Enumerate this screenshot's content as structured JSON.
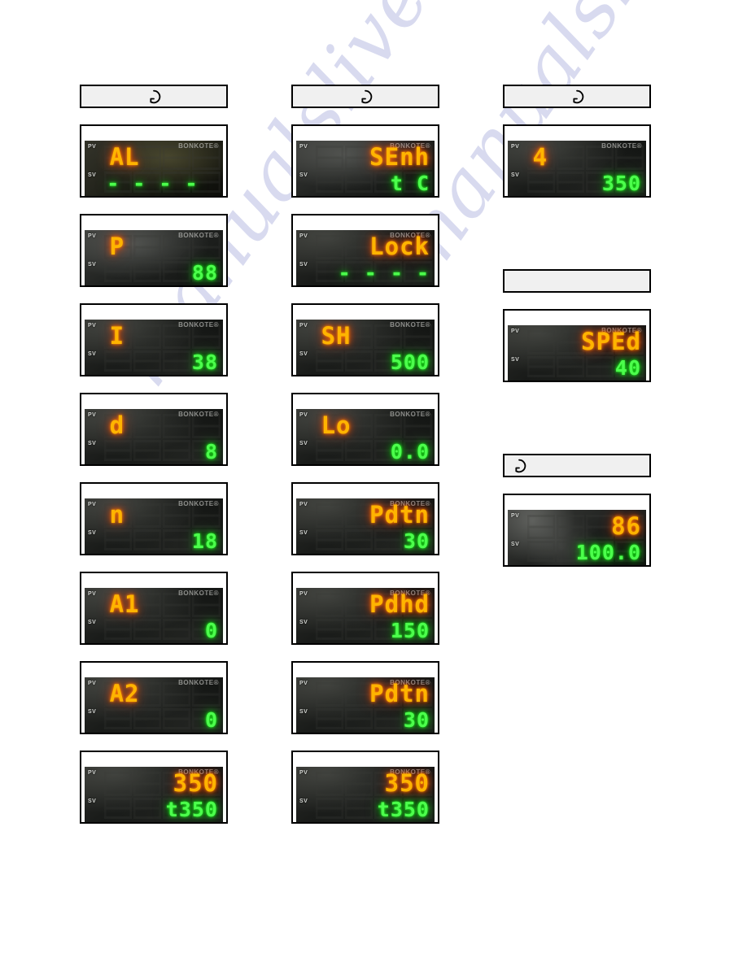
{
  "page": {
    "watermark": "manualslive.com",
    "brand": "BONKOTE®",
    "pv_tag": "PV",
    "sv_tag": "SV"
  },
  "icons": {
    "cycle": "circular-arrow-icon"
  },
  "columns": [
    {
      "id": "column-1",
      "header": {
        "icon": "circular-arrow-icon",
        "align": "center",
        "label": ""
      },
      "panels": [
        {
          "id": "c1-p1",
          "pv": "AL",
          "sv": "- - - -",
          "pv_align": "left",
          "sv_align": "left",
          "screen": "olive"
        },
        {
          "id": "c1-p2",
          "pv": "P",
          "sv": "88",
          "pv_align": "left",
          "sv_align": "right",
          "screen": "grey"
        },
        {
          "id": "c1-p3",
          "pv": "I",
          "sv": "38",
          "pv_align": "left",
          "sv_align": "right",
          "screen": "dark"
        },
        {
          "id": "c1-p4",
          "pv": "d",
          "sv": "8",
          "pv_align": "left",
          "sv_align": "right",
          "screen": "dark"
        },
        {
          "id": "c1-p5",
          "pv": "n",
          "sv": "18",
          "pv_align": "left",
          "sv_align": "right",
          "screen": "dark"
        },
        {
          "id": "c1-p6",
          "pv": "A1",
          "sv": "0",
          "pv_align": "left",
          "sv_align": "right",
          "screen": "dark"
        },
        {
          "id": "c1-p7",
          "pv": "A2",
          "sv": "0",
          "pv_align": "left",
          "sv_align": "right",
          "screen": "dark"
        },
        {
          "id": "c1-p8",
          "pv": "350",
          "sv": "t350",
          "pv_align": "right",
          "sv_align": "right",
          "screen": "dark"
        }
      ]
    },
    {
      "id": "column-2",
      "header": {
        "icon": "circular-arrow-icon",
        "align": "center",
        "label": ""
      },
      "panels": [
        {
          "id": "c2-p1",
          "pv": "SEnh",
          "sv": "t    C",
          "pv_align": "right",
          "sv_align": "right",
          "screen": "grey"
        },
        {
          "id": "c2-p2",
          "pv": "Lock",
          "sv": "- - - -",
          "pv_align": "right",
          "sv_align": "right",
          "screen": "dark"
        },
        {
          "id": "c2-p3",
          "pv": "SH",
          "sv": "500",
          "pv_align": "left",
          "sv_align": "right",
          "screen": "dark"
        },
        {
          "id": "c2-p4",
          "pv": "Lo",
          "sv": "0.0",
          "pv_align": "left",
          "sv_align": "right",
          "screen": "dark"
        },
        {
          "id": "c2-p5",
          "pv": "Pdtn",
          "sv": "30",
          "pv_align": "right",
          "sv_align": "right",
          "screen": "dark"
        },
        {
          "id": "c2-p6",
          "pv": "Pdhd",
          "sv": "150",
          "pv_align": "right",
          "sv_align": "right",
          "screen": "dark"
        },
        {
          "id": "c2-p7",
          "pv": "Pdtn",
          "sv": "30",
          "pv_align": "right",
          "sv_align": "right",
          "screen": "dark"
        },
        {
          "id": "c2-p8",
          "pv": "350",
          "sv": "t350",
          "pv_align": "right",
          "sv_align": "right",
          "screen": "dark"
        }
      ]
    },
    {
      "id": "column-3",
      "groups": [
        {
          "header": {
            "icon": "circular-arrow-icon",
            "align": "center",
            "label": ""
          },
          "panels": [
            {
              "id": "c3-p1",
              "pv": "4",
              "sv": "350",
              "pv_align": "left",
              "sv_align": "right",
              "screen": "dark"
            }
          ]
        },
        {
          "header": {
            "icon": "",
            "align": "center",
            "label": ""
          },
          "panels": [
            {
              "id": "c3-p2",
              "pv": "SPEd",
              "sv": "40",
              "pv_align": "right",
              "sv_align": "right",
              "screen": "dark"
            }
          ]
        },
        {
          "header": {
            "icon": "circular-arrow-icon",
            "align": "left",
            "label": ""
          },
          "panels": [
            {
              "id": "c3-p3",
              "pv": "86",
              "sv": "100.0",
              "pv_align": "right",
              "sv_align": "right",
              "screen": "speckle"
            }
          ]
        }
      ]
    }
  ]
}
